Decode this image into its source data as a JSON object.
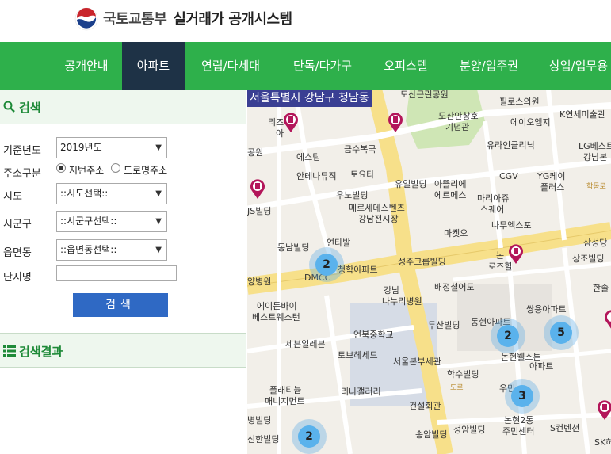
{
  "header": {
    "ministry": "국토교통부",
    "system": "실거래가 공개시스템"
  },
  "nav": {
    "items": [
      "공개안내",
      "아파트",
      "연립/다세대",
      "단독/다가구",
      "오피스텔",
      "분양/입주권",
      "상업/업무용"
    ],
    "active": "아파트"
  },
  "search": {
    "title": "검색",
    "year_label": "기준년도",
    "year_value": "2019년도",
    "addr_type_label": "주소구분",
    "addr_opt1": "지번주소",
    "addr_opt2": "도로명주소",
    "sido_label": "시도",
    "sido_value": "::시도선택::",
    "sigungu_label": "시군구",
    "sigungu_value": "::시군구선택::",
    "dong_label": "읍면동",
    "dong_value": "::읍면동선택::",
    "complex_label": "단지명",
    "complex_value": "",
    "button": "검색"
  },
  "results": {
    "title": "검색결과"
  },
  "map": {
    "location": "서울특별시 강남구 청담동",
    "clusters": [
      "2",
      "2",
      "5",
      "3",
      "2"
    ],
    "labels": {
      "l1": "도산근린공원",
      "l2": "필로스의원",
      "l3": "도산안창호",
      "l4": "기념관",
      "l5": "에이오엠지",
      "l6": "K연세미술관",
      "l7": "리즈",
      "l8": "아",
      "l9": "유라인클리닉",
      "l10": "LG베스트",
      "l11": "강남본",
      "l12": "공원",
      "l13": "에스팀",
      "l14": "금수복국",
      "l15": "CGV",
      "l16": "YG케이",
      "l17": "플러스",
      "l18": "안테나뮤직",
      "l19": "토요타",
      "l20": "유일빌딩",
      "l21": "아뜰리에",
      "l22": "에르메스",
      "l23": "마리아쥬",
      "l24": "스퀘어",
      "l25": "JS빌딩",
      "l26": "우노빌딩",
      "l27": "메르세데스벤츠",
      "l28": "강남전시장",
      "l29": "나무엑스포",
      "l30": "마켓오",
      "l31": "동남빌딩",
      "l32": "연타발",
      "l33": "삼성당",
      "l34": "논",
      "l35": "로즈힐",
      "l36": "상조빌딩",
      "l37": "DMCC",
      "l38": "청학아파트",
      "l39": "성주그룹빌딩",
      "l40": "강남",
      "l41": "나누리병원",
      "l42": "배정철어도",
      "l43": "양병원",
      "l44": "한솔",
      "l45": "에이든바이",
      "l46": "베스트웨스턴",
      "l47": "두산빌딩",
      "l48": "쌍용아파트",
      "l49": "동현아파트",
      "l50": "세븐일레븐",
      "l51": "언북중학교",
      "l52": "토브헤세드",
      "l53": "서울본부세관",
      "l54": "논현웰스톤",
      "l55": "아파트",
      "l56": "학수빌딩",
      "l57": "플래티늄",
      "l58": "매니지먼트",
      "l59": "리나갤러리",
      "l60": "우민",
      "l61": "건설회관",
      "l62": "논현2동",
      "l63": "주민센터",
      "l64": "병빌딩",
      "l65": "신한빌딩",
      "l66": "송암빌딩",
      "l67": "성암빌딩",
      "l68": "S컨벤션",
      "l69": "SK허",
      "l70": "도로",
      "l71": "학동로"
    }
  },
  "colors": {
    "nav_bg": "#2eb04b",
    "nav_active": "#1e3246",
    "search_btn": "#2f69c4",
    "section_title": "#1e8a38",
    "map_title_bg": "#3a3f93",
    "cluster": "#5ab2ec",
    "marker": "#b3165a"
  }
}
